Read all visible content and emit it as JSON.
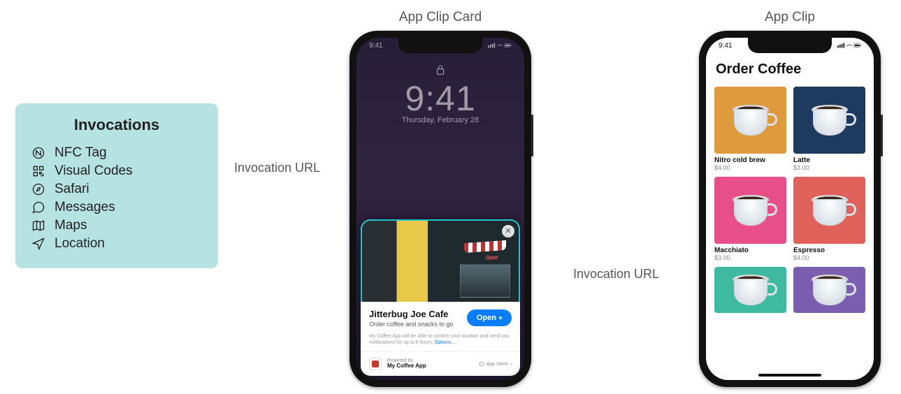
{
  "headers": {
    "card": "App Clip Card",
    "clip": "App Clip"
  },
  "invocations": {
    "title": "Invocations",
    "items": [
      {
        "icon": "nfc-icon",
        "label": "NFC Tag"
      },
      {
        "icon": "qr-icon",
        "label": "Visual Codes"
      },
      {
        "icon": "compass-icon",
        "label": "Safari"
      },
      {
        "icon": "message-icon",
        "label": "Messages"
      },
      {
        "icon": "map-icon",
        "label": "Maps"
      },
      {
        "icon": "location-icon",
        "label": "Location"
      }
    ]
  },
  "arrows": {
    "a1": "Invocation URL",
    "a2": "Invocation URL"
  },
  "phone1": {
    "status_time": "9:41",
    "lock_time": "9:41",
    "lock_date": "Thursday, February 28",
    "card": {
      "open_sign": "Open",
      "title": "Jitterbug Joe Cafe",
      "subtitle": "Order coffee and snacks to go",
      "open_btn": "Open",
      "fine_print": "My Coffee App will be able to confirm your location and send you notifications for up to 8 hours.",
      "options": "Options…",
      "powered_by": "Powered by",
      "app_name": "My Coffee App",
      "appstore": "App Store"
    }
  },
  "phone2": {
    "status_time": "9:41",
    "header": "Order Coffee",
    "products": [
      {
        "name": "Nitro cold brew",
        "price": "$4.00",
        "color": "#E09A3E"
      },
      {
        "name": "Latte",
        "price": "$3.00",
        "color": "#1E3A5F"
      },
      {
        "name": "Macchiato",
        "price": "$3.00",
        "color": "#E84F8A"
      },
      {
        "name": "Espresso",
        "price": "$4.00",
        "color": "#E0615A"
      },
      {
        "name": "",
        "price": "",
        "color": "#3EBA0"
      },
      {
        "name": "",
        "price": "",
        "color": "#7A5FB0"
      }
    ]
  }
}
